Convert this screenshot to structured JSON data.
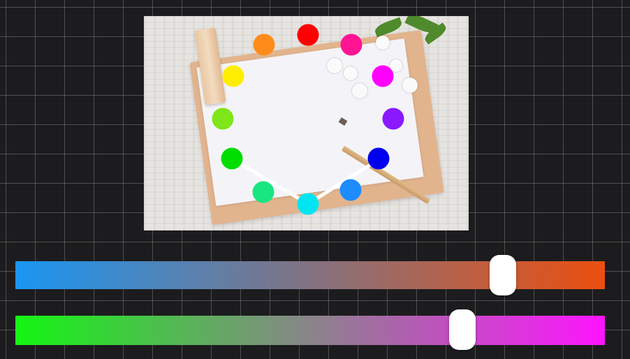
{
  "photo": {
    "description_icon": "notepad-photo"
  },
  "hue_wheel": {
    "dots": [
      {
        "id": "red",
        "color": "#ff0000"
      },
      {
        "id": "rose",
        "color": "#ff1493"
      },
      {
        "id": "magenta",
        "color": "#ff00ff"
      },
      {
        "id": "violet",
        "color": "#8a19ff"
      },
      {
        "id": "blue",
        "color": "#0000ee"
      },
      {
        "id": "azure",
        "color": "#1e8cff"
      },
      {
        "id": "cyan",
        "color": "#00e5f0"
      },
      {
        "id": "spring-green",
        "color": "#19e680"
      },
      {
        "id": "green",
        "color": "#00dd00"
      },
      {
        "id": "chartreuse",
        "color": "#7ee61a"
      },
      {
        "id": "yellow",
        "color": "#ffee00"
      },
      {
        "id": "orange",
        "color": "#ff8c1a"
      }
    ],
    "selection_path": [
      "green",
      "cyan",
      "blue"
    ]
  },
  "sliders": [
    {
      "id": "blue-orange",
      "start_color": "#1a96f2",
      "end_color": "#ec4f10",
      "value": 0.827
    },
    {
      "id": "green-magenta",
      "start_color": "#14f514",
      "end_color": "#ff14ff",
      "value": 0.758
    }
  ]
}
